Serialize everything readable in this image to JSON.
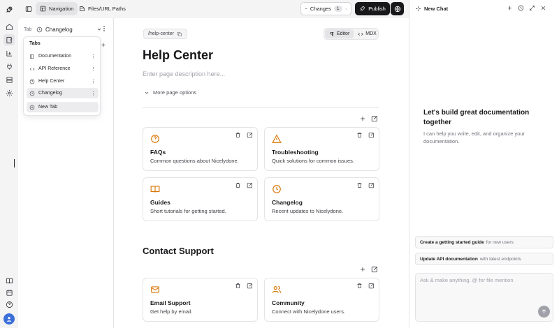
{
  "topbar": {
    "navigation_label": "Navigation",
    "files_label": "Files/URL Paths",
    "changes_label": "Changes",
    "changes_count": "1",
    "publish_label": "Publish"
  },
  "sidebar": {
    "tab_label": "Tab",
    "tab_selected": "Changelog"
  },
  "tabs_menu": {
    "header": "Tabs",
    "items": [
      {
        "label": "Documentation",
        "icon": "book-icon"
      },
      {
        "label": "API Reference",
        "icon": "code-icon"
      },
      {
        "label": "Help Center",
        "icon": "help-circle-icon"
      },
      {
        "label": "Changelog",
        "icon": "clock-icon",
        "selected": true
      }
    ],
    "new_tab_label": "New Tab"
  },
  "page": {
    "path": "/help-center",
    "mode_editor": "Editor",
    "mode_mdx": "MDX",
    "title": "Help Center",
    "description_placeholder": "Enter page description here...",
    "more_options": "More page options",
    "cards": [
      {
        "title": "FAQs",
        "description": "Common questions about Nicelydone.",
        "icon": "help-circle-icon"
      },
      {
        "title": "Troubleshooting",
        "description": "Quick solutions for common issues.",
        "icon": "warning-icon"
      },
      {
        "title": "Guides",
        "description": "Short tutorials for getting started.",
        "icon": "book-open-icon"
      },
      {
        "title": "Changelog",
        "description": "Recent updates to Nicelydone.",
        "icon": "clock-icon"
      }
    ],
    "contact_title": "Contact Support",
    "contact_cards": [
      {
        "title": "Email Support",
        "description": "Get help by email.",
        "icon": "mail-icon"
      },
      {
        "title": "Community",
        "description": "Connect with Nicelydone users.",
        "icon": "users-icon"
      }
    ]
  },
  "chat": {
    "title": "New Chat",
    "welcome_heading": "Let's build great documentation together",
    "welcome_text": "I can help you write, edit, and organize your documentation.",
    "suggestions": [
      {
        "bold": "Create a getting started guide",
        "rest": "for new users"
      },
      {
        "bold": "Update API documentation",
        "rest": "with latest endpoints"
      }
    ],
    "input_placeholder": "Ask & make anything, @ for file mention"
  },
  "colors": {
    "accent_icon": "#d97706",
    "publish_bg": "#18181b",
    "avatar": "#3b6fd8"
  }
}
